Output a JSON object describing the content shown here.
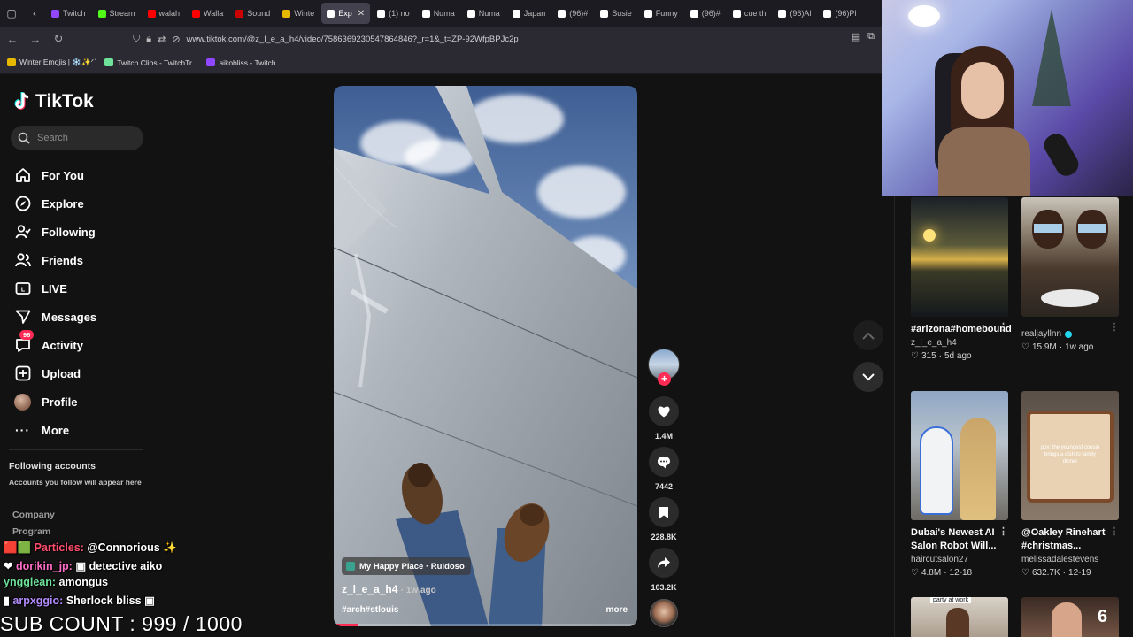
{
  "browser": {
    "tabs": [
      {
        "label": "Twitch",
        "color": "#9146ff",
        "active": false
      },
      {
        "label": "Stream",
        "color": "#53fc18",
        "active": false
      },
      {
        "label": "walah",
        "color": "#ff0000",
        "active": false
      },
      {
        "label": "Walla",
        "color": "#ff0000",
        "active": false
      },
      {
        "label": "Sound",
        "color": "#cc0000",
        "active": false
      },
      {
        "label": "Winte",
        "color": "#e6b800",
        "active": false
      },
      {
        "label": "Exp",
        "color": "#ffffff",
        "active": true
      },
      {
        "label": "(1) no",
        "color": "#ffffff",
        "active": false
      },
      {
        "label": "Numa",
        "color": "#ffffff",
        "active": false
      },
      {
        "label": "Numa",
        "color": "#ffffff",
        "active": false
      },
      {
        "label": "Japan",
        "color": "#ffffff",
        "active": false
      },
      {
        "label": "(96)#",
        "color": "#ffffff",
        "active": false
      },
      {
        "label": "Susie",
        "color": "#ffffff",
        "active": false
      },
      {
        "label": "Funny",
        "color": "#ffffff",
        "active": false
      },
      {
        "label": "(96)#",
        "color": "#ffffff",
        "active": false
      },
      {
        "label": "cue th",
        "color": "#ffffff",
        "active": false
      },
      {
        "label": "(96)Al",
        "color": "#ffffff",
        "active": false
      },
      {
        "label": "(96)Pl",
        "color": "#ffffff",
        "active": false
      }
    ],
    "url": "www.tiktok.com/@z_l_e_a_h4/video/7586369230547864846?_r=1&_t=ZP-92WfpBPJc2p",
    "bookmarks": [
      {
        "label": "Winter Emojis | ❄️✨ᐟᐝ",
        "color": "#e6b800"
      },
      {
        "label": "Twitch Clips - TwitchTr...",
        "color": "#6fe29a"
      },
      {
        "label": "aikobliss - Twitch",
        "color": "#9146ff"
      }
    ]
  },
  "tiktok": {
    "logo_text": "TikTok",
    "search_placeholder": "Search",
    "nav": [
      {
        "label": "For You",
        "icon": "home-icon"
      },
      {
        "label": "Explore",
        "icon": "compass-icon"
      },
      {
        "label": "Following",
        "icon": "person-check-icon"
      },
      {
        "label": "Friends",
        "icon": "friends-icon"
      },
      {
        "label": "LIVE",
        "icon": "live-icon"
      },
      {
        "label": "Messages",
        "icon": "send-icon"
      },
      {
        "label": "Activity",
        "icon": "bell-icon",
        "badge": "96"
      },
      {
        "label": "Upload",
        "icon": "plus-square-icon"
      },
      {
        "label": "Profile",
        "icon": "avatar"
      },
      {
        "label": "More",
        "icon": "more-icon"
      }
    ],
    "following_title": "Following accounts",
    "following_sub": "Accounts you follow will appear here",
    "footer_1": "Company",
    "footer_2": "Program"
  },
  "video": {
    "location": "My Happy Place · Ruidoso",
    "author": "z_l_e_a_h4",
    "ago": "· 1w ago",
    "caption": "#arch#stlouis",
    "more": "more",
    "progress": 0.08,
    "likes": "1.4M",
    "comments": "7442",
    "saves": "228.8K",
    "shares": "103.2K"
  },
  "recommendations": [
    {
      "title": "#arizona#homebound",
      "author": "z_l_e_a_h4",
      "verified": false,
      "likes": "315",
      "date": "5d ago",
      "thumb": "sunset"
    },
    {
      "title": "",
      "author": "realjayllnn",
      "verified": true,
      "likes": "15.9M",
      "date": "1w ago",
      "thumb": "eating"
    },
    {
      "title": "Dubai's Newest AI Salon Robot Will...",
      "author": "haircutsalon27",
      "verified": false,
      "likes": "4.8M",
      "date": "12-18",
      "thumb": "robot"
    },
    {
      "title": "@Oakley Rinehart #christmas...",
      "author": "melissadalestevens",
      "verified": false,
      "likes": "632.7K",
      "date": "12-19",
      "thumb": "dish",
      "overlay_text": "pov: the youngest cousin brings a dish to family dinner"
    },
    {
      "title": "",
      "author": "",
      "verified": false,
      "likes": "",
      "date": "",
      "thumb": "party",
      "overlay_text": "party at work"
    },
    {
      "title": "",
      "author": "",
      "verified": false,
      "likes": "",
      "date": "",
      "thumb": "girl"
    }
  ],
  "stream": {
    "chat": [
      {
        "user": "Particles:",
        "msg": "@Connorious",
        "color": "u1"
      },
      {
        "user": "dorikin_jp:",
        "msg": "detective aiko",
        "color": "u2"
      },
      {
        "user": "yngglean:",
        "msg": "amongus",
        "color": "u3"
      },
      {
        "user": "arpxggio:",
        "msg": "Sherlock bliss",
        "color": "u4"
      }
    ],
    "sub_count": "SUB COUNT : 999 / 1000",
    "corner_number": "6"
  }
}
